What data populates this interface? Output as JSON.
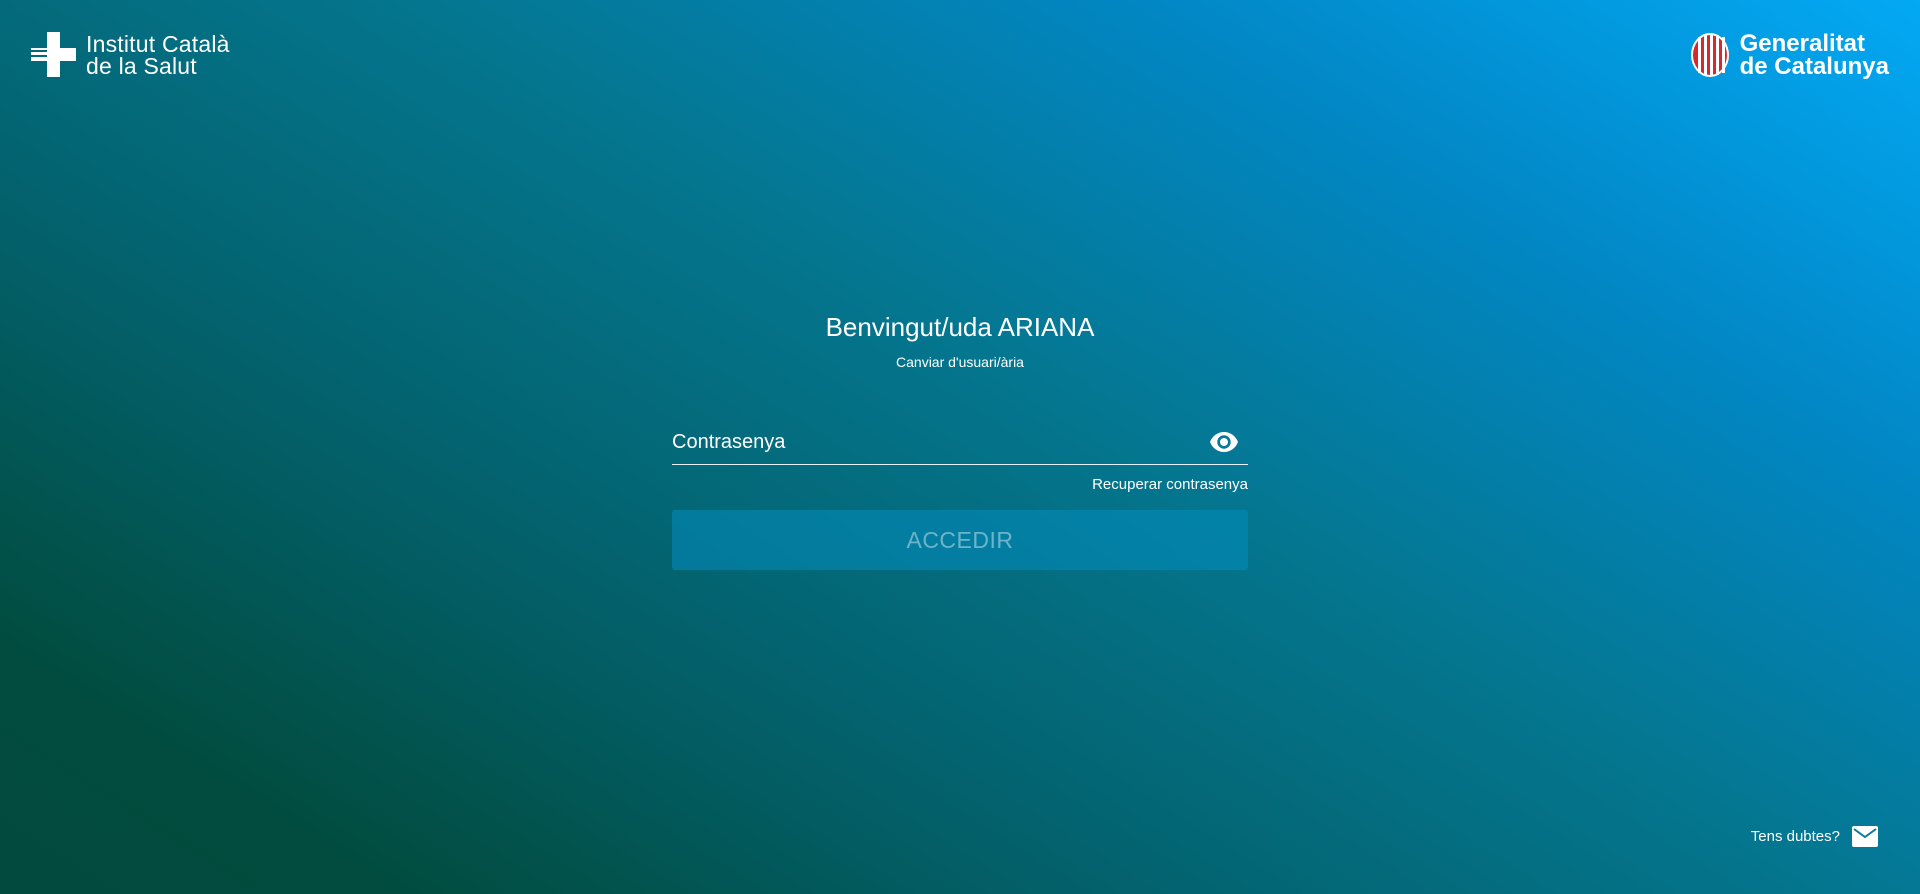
{
  "header": {
    "left_brand": {
      "line1": "Institut Català",
      "line2": "de la Salut",
      "icon": "ics-cross-logo"
    },
    "right_brand": {
      "line1": "Generalitat",
      "line2": "de Catalunya",
      "icon": "gencat-logo"
    }
  },
  "login": {
    "welcome": "Benvingut/uda ARIANA",
    "change_user_link": "Canviar d'usuari/ària",
    "password_placeholder": "Contrasenya",
    "password_value": "",
    "toggle_visibility_icon": "eye-icon",
    "recover_link": "Recuperar contrasenya",
    "submit_label": "ACCEDIR"
  },
  "footer": {
    "help_label": "Tens dubtes?",
    "help_icon": "mail-icon"
  },
  "colors": {
    "gradient_top_right": "#03a9f4",
    "gradient_bottom_left": "#024a3d",
    "gencat_red": "#d42a2f",
    "text": "#ffffff"
  }
}
